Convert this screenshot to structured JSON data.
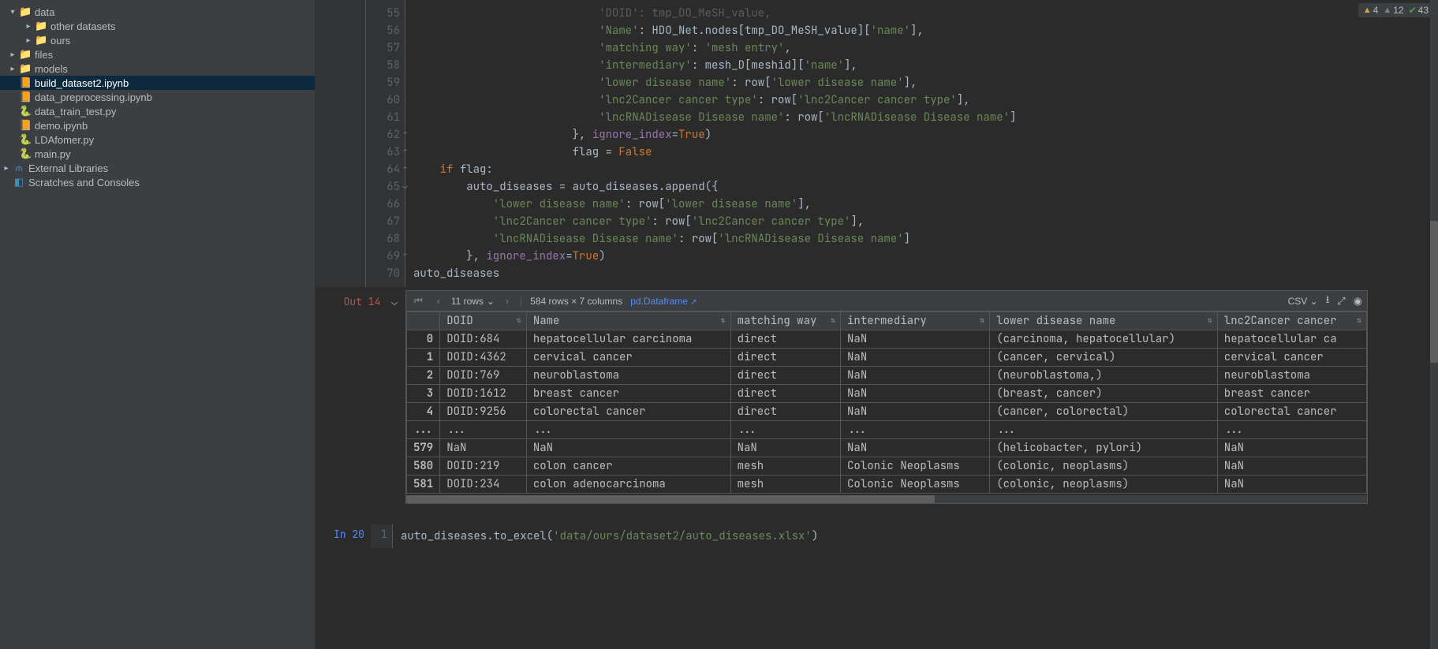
{
  "tree": {
    "data": "data",
    "other_datasets": "other datasets",
    "ours": "ours",
    "files": "files",
    "models": "models",
    "build_dataset2": "build_dataset2.ipynb",
    "data_preprocessing": "data_preprocessing.ipynb",
    "data_train_test": "data_train_test.py",
    "demo": "demo.ipynb",
    "ldafomer": "LDAfomer.py",
    "main_py": "main.py",
    "ext_lib": "External Libraries",
    "scratches": "Scratches and Consoles"
  },
  "indicators": {
    "warn": "4",
    "weak": "12",
    "ok": "43"
  },
  "code": {
    "l55": "                            'DOID': tmp_DO_MeSH_value,",
    "l56_a": "                            ",
    "l56_k": "'Name'",
    "l56_b": ": HDO_Net.nodes[tmp_DO_MeSH_value][",
    "l56_c": "'name'",
    "l56_d": "],",
    "l57_a": "                            ",
    "l57_k": "'matching way'",
    "l57_b": ": ",
    "l57_c": "'mesh entry'",
    "l57_d": ",",
    "l58_a": "                            ",
    "l58_k": "'intermediary'",
    "l58_b": ": mesh_D[meshid][",
    "l58_c": "'name'",
    "l58_d": "],",
    "l59_a": "                            ",
    "l59_k": "'lower disease name'",
    "l59_b": ": row[",
    "l59_c": "'lower disease name'",
    "l59_d": "],",
    "l60_a": "                            ",
    "l60_k": "'lnc2Cancer cancer type'",
    "l60_b": ": row[",
    "l60_c": "'lnc2Cancer cancer type'",
    "l60_d": "],",
    "l61_a": "                            ",
    "l61_k": "'lncRNADisease Disease name'",
    "l61_b": ": row[",
    "l61_c": "'lncRNADisease Disease name'",
    "l61_d": "]",
    "l62_a": "                        }, ",
    "l62_k": "ignore_index",
    "l62_b": "=",
    "l62_c": "True",
    "l62_d": ")",
    "l63_a": "                        flag = ",
    "l63_b": "False",
    "l64_a": "    ",
    "l64_if": "if ",
    "l64_b": "flag:",
    "l65_a": "        auto_diseases = auto_diseases.append({",
    "l66_a": "            ",
    "l66_k": "'lower disease name'",
    "l66_b": ": row[",
    "l66_c": "'lower disease name'",
    "l66_d": "],",
    "l67_a": "            ",
    "l67_k": "'lnc2Cancer cancer type'",
    "l67_b": ": row[",
    "l67_c": "'lnc2Cancer cancer type'",
    "l67_d": "],",
    "l68_a": "            ",
    "l68_k": "'lncRNADisease Disease name'",
    "l68_b": ": row[",
    "l68_c": "'lncRNADisease Disease name'",
    "l68_d": "]",
    "l69_a": "        }, ",
    "l69_k": "ignore_index",
    "l69_b": "=",
    "l69_c": "True",
    "l69_d": ")",
    "l70": "auto_diseases",
    "lnStart": 55,
    "lnEnd": 70
  },
  "out": {
    "label": "Out 14"
  },
  "df_toolbar": {
    "rows_sel": "11 rows",
    "dim": "584 rows × 7 columns",
    "pd": "pd.Dataframe",
    "csv": "CSV"
  },
  "df": {
    "cols": [
      "",
      "DOID",
      "Name",
      "matching way",
      "intermediary",
      "lower disease name",
      "lnc2Cancer cancer"
    ],
    "rows": [
      [
        "0",
        "DOID:684",
        "hepatocellular carcinoma",
        "direct",
        "NaN",
        "(carcinoma, hepatocellular)",
        "hepatocellular ca"
      ],
      [
        "1",
        "DOID:4362",
        "cervical cancer",
        "direct",
        "NaN",
        "(cancer, cervical)",
        "cervical cancer"
      ],
      [
        "2",
        "DOID:769",
        "neuroblastoma",
        "direct",
        "NaN",
        "(neuroblastoma,)",
        "neuroblastoma"
      ],
      [
        "3",
        "DOID:1612",
        "breast cancer",
        "direct",
        "NaN",
        "(breast, cancer)",
        "breast cancer"
      ],
      [
        "4",
        "DOID:9256",
        "colorectal cancer",
        "direct",
        "NaN",
        "(cancer, colorectal)",
        "colorectal cancer"
      ]
    ],
    "ellipsis": [
      "...",
      "...",
      "...",
      "...",
      "...",
      "...",
      "..."
    ],
    "rows2": [
      [
        "579",
        "NaN",
        "NaN",
        "NaN",
        "NaN",
        "(helicobacter, pylori)",
        "NaN"
      ],
      [
        "580",
        "DOID:219",
        "colon cancer",
        "mesh",
        "Colonic Neoplasms",
        "(colonic, neoplasms)",
        "NaN"
      ],
      [
        "581",
        "DOID:234",
        "colon adenocarcinoma",
        "mesh",
        "Colonic Neoplasms",
        "(colonic, neoplasms)",
        "NaN"
      ]
    ]
  },
  "in2": {
    "label": "In 20",
    "ln": "1",
    "code_a": "auto_diseases.to_excel(",
    "code_s": "'data/ours/dataset2/auto_diseases.xlsx'",
    "code_b": ")"
  }
}
